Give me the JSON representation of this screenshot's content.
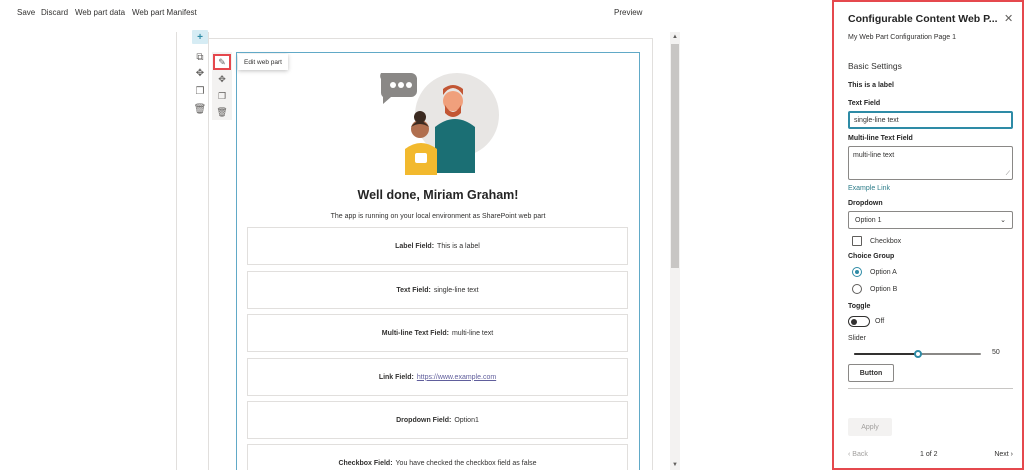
{
  "command_bar": {
    "save": "Save",
    "discard": "Discard",
    "web_part_data": "Web part data",
    "web_part_manifest": "Web part Manifest",
    "preview": "Preview"
  },
  "canvas_toolbar": {
    "add": "+",
    "section": "⧉",
    "move": "✥",
    "duplicate": "❐",
    "delete": "🗑"
  },
  "webpart_toolbar": {
    "edit": "✎",
    "move": "✥",
    "duplicate": "❐",
    "delete": "🗑",
    "tooltip": "Edit web part"
  },
  "webpart": {
    "title": "Well done, Miriam Graham!",
    "subtitle": "The app is running on your local environment as SharePoint web part",
    "fields": [
      {
        "label": "Label Field:",
        "value": "This is a label"
      },
      {
        "label": "Text Field:",
        "value": "single-line text"
      },
      {
        "label": "Multi-line Text Field:",
        "value": "multi-line text"
      },
      {
        "label": "Link Field:",
        "value": "https://www.example.com"
      },
      {
        "label": "Dropdown Field:",
        "value": "Option1"
      },
      {
        "label": "Checkbox Field:",
        "value": "You have checked the checkbox field as false"
      }
    ]
  },
  "scrollbar": {
    "up": "▲",
    "down": "▼"
  },
  "pane": {
    "title": "Configurable Content Web P...",
    "close": "✕",
    "description": "My Web Part Configuration Page 1",
    "group_title": "Basic Settings",
    "label_text": "This is a label",
    "text_field_label": "Text Field",
    "text_field_value": "single-line text",
    "multiline_label": "Multi-line Text Field",
    "multiline_value": "multi-line text",
    "resize_glyph": "⟋",
    "link": "Example Link",
    "dropdown_label": "Dropdown",
    "dropdown_value": "Option 1",
    "dropdown_chevron": "⌄",
    "checkbox_label": "Checkbox",
    "checkbox_checked": false,
    "choice_label": "Choice Group",
    "choice_options": [
      "Option A",
      "Option B"
    ],
    "choice_selected": 0,
    "toggle_label": "Toggle",
    "toggle_state": "Off",
    "slider_label": "Slider",
    "slider_value": "50",
    "slider_fraction": 0.5,
    "button_label": "Button",
    "apply_label": "Apply",
    "back_label": "‹  Back",
    "page_indicator": "1 of 2",
    "next_label": "Next  ›"
  },
  "colors": {
    "accent": "#2e8ba6",
    "highlight_border": "#e5484d",
    "webpart_border": "#61a9c7"
  }
}
